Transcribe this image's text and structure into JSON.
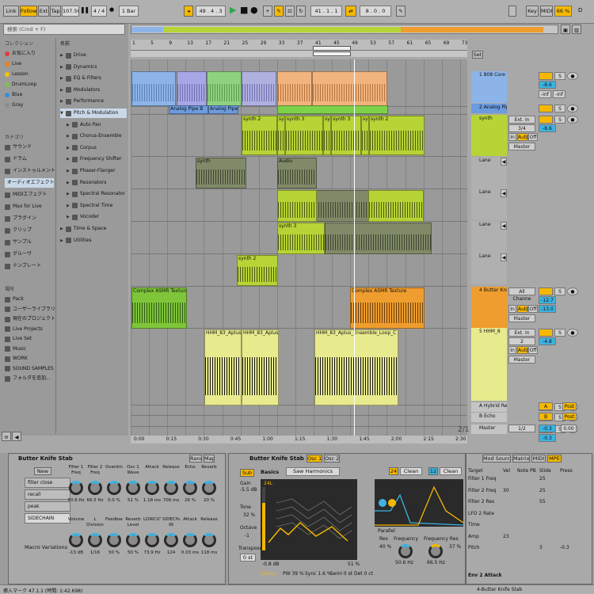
{
  "transport": {
    "link": "Link",
    "follow": "Follow",
    "ext": "Ext",
    "tap": "Tap",
    "tempo": "107.50",
    "signature": "4 / 4",
    "quantize": "1 Bar",
    "position": "49 . 4 . 3",
    "loop_start": "41 . 1 . 1",
    "loop_length": "8 . 0 . 0",
    "key": "Key",
    "midi": "MIDI",
    "cpu": "66 %",
    "d_label": "D"
  },
  "browser": {
    "search_placeholder": "検索 (Cmd + F)",
    "collections_title": "コレクション",
    "collections": [
      {
        "label": "お気に入り",
        "color": "#e03c3c"
      },
      {
        "label": "Live",
        "color": "#f07f1a"
      },
      {
        "label": "Lesson",
        "color": "#f3c300"
      },
      {
        "label": "DrumLoop",
        "color": "#7cc24a"
      },
      {
        "label": "Blue",
        "color": "#3a8edb"
      },
      {
        "label": "Gray",
        "color": "#8c8c8c"
      }
    ],
    "categories_title": "カテゴリ",
    "categories": [
      "サウンド",
      "ドラム",
      "インストゥルメント",
      "オーディオエフェクト",
      "MIDIエフェクト",
      "Max for Live",
      "プラグイン",
      "クリップ",
      "サンプル",
      "グルーヴ",
      "テンプレート"
    ],
    "places_title": "場所",
    "places": [
      "Pack",
      "ユーザーライブラリ",
      "現在のプロジェクト",
      "Live Projects",
      "Live Set",
      "Music",
      "WORK",
      "SOUND SAMPLES",
      "フォルダを追加..."
    ],
    "name_header": "名前",
    "items": [
      {
        "label": "Drive",
        "indent": 0
      },
      {
        "label": "Dynamics",
        "indent": 0
      },
      {
        "label": "EQ & Filters",
        "indent": 0
      },
      {
        "label": "Modulators",
        "indent": 0
      },
      {
        "label": "Performance",
        "indent": 0
      },
      {
        "label": "Pitch & Modulation",
        "indent": 0
      },
      {
        "label": "Auto Pan",
        "indent": 1
      },
      {
        "label": "Chorus-Ensemble",
        "indent": 1
      },
      {
        "label": "Corpus",
        "indent": 1
      },
      {
        "label": "Frequency Shifter",
        "indent": 1
      },
      {
        "label": "Phaser-Flanger",
        "indent": 1
      },
      {
        "label": "Resonators",
        "indent": 1
      },
      {
        "label": "Spectral Resonator",
        "indent": 1
      },
      {
        "label": "Spectral Time",
        "indent": 1
      },
      {
        "label": "Vocoder",
        "indent": 1
      },
      {
        "label": "Time & Space",
        "indent": 0
      },
      {
        "label": "Utilities",
        "indent": 0
      }
    ]
  },
  "ruler": [
    "1",
    "5",
    "9",
    "13",
    "17",
    "21",
    "25",
    "29",
    "33",
    "37",
    "41",
    "45",
    "49",
    "53",
    "57",
    "61",
    "65",
    "69",
    "73"
  ],
  "time_ruler": [
    "0:00",
    "0:15",
    "0:30",
    "0:45",
    "1:00",
    "1:15",
    "1:30",
    "1:45",
    "2:00",
    "2:15",
    "2:30"
  ],
  "page_indicator": "2/1",
  "tracks": [
    {
      "name": "1 808 Core K",
      "color": "#8db4e8",
      "vol": "-8.6",
      "sends": "-inf",
      "clips": []
    },
    {
      "name": "2 Analog Pip",
      "color": "#6c9bde",
      "clips": [
        {
          "label": "Analog Pipe B"
        },
        {
          "label": "Analog Pipe Bass"
        },
        {
          "label": "Al"
        },
        {
          "label": "Anal"
        }
      ]
    },
    {
      "name": "synth",
      "color": "#b7d437",
      "input": "Ext. In",
      "chan": "3/4",
      "vol": "-8.6",
      "out": "Master",
      "clips": [
        {
          "label": "synth 2"
        },
        {
          "label": "sy"
        },
        {
          "label": "synth 3"
        },
        {
          "label": "sy"
        },
        {
          "label": "synth 3"
        },
        {
          "label": "sy"
        },
        {
          "label": "synth 2"
        }
      ]
    },
    {
      "name": "Lane",
      "clips": [
        {
          "label": "synth"
        },
        {
          "label": "Audio"
        }
      ]
    },
    {
      "name": "Lane",
      "clips": [
        {
          "label": "synth 2"
        }
      ]
    },
    {
      "name": "Lane",
      "clips": [
        {
          "label": "synth 3"
        }
      ]
    },
    {
      "name": "Lane",
      "clips": [
        {
          "label": "synth 2"
        }
      ]
    },
    {
      "name": "4 Butter Kni",
      "color": "#ef9d2e",
      "input": "All Channe",
      "vol": "-12.7",
      "send": "-13.0",
      "out": "Master",
      "clips": [
        {
          "label": "Complex ASMR Texture"
        },
        {
          "label": "Complex ASMR Texture"
        }
      ]
    },
    {
      "name": "5 HHM_8",
      "color": "#e8ea8e",
      "input": "Ext. In",
      "chan": "2",
      "vol": "-4.8",
      "out": "Master",
      "clips": [
        {
          "label": "HHM_83_Aplus_Es"
        },
        {
          "label": "HHM_83_Aplus_Es"
        },
        {
          "label": "HHM_83_Aplus_Ensemble_Loop_C"
        }
      ]
    },
    {
      "name": "A Hybrid Re",
      "send_label": "A",
      "post": "Post"
    },
    {
      "name": "B Echo",
      "send_label": "B",
      "post": "Post"
    },
    {
      "name": "Master",
      "quant": "1/2",
      "vol": "-0.3",
      "val2": "0.00"
    }
  ],
  "mixer_labels": {
    "in": "In",
    "auto": "Auto",
    "off": "Off",
    "s": "S",
    "c": "C",
    "set": "Set",
    "inf": "-inf",
    "master": "Master"
  },
  "rack": {
    "title": "Butter Knife Stab",
    "rand": "Rand",
    "map": "Map",
    "new": "New",
    "presets": [
      "filter close",
      "recall",
      "peak",
      "SIDECHAIN"
    ],
    "macro_variations": "Macro Variations",
    "macros": [
      {
        "label": "Filter 1 Freq",
        "value": "50.6 Hz"
      },
      {
        "label": "Filter 2 Freq",
        "value": "66.5 Hz"
      },
      {
        "label": "Overdrive",
        "value": "0.0 %"
      },
      {
        "label": "Osc 1 Wave",
        "value": "51 %"
      },
      {
        "label": "Attack",
        "value": "1.18 ms"
      },
      {
        "label": "Release",
        "value": "706 ms"
      },
      {
        "label": "Echo",
        "value": "26 %"
      },
      {
        "label": "Reverb",
        "value": "20 %"
      },
      {
        "label": "Volume",
        "value": "-13 dB"
      },
      {
        "label": "L Division",
        "value": "1/16"
      },
      {
        "label": "Feedback",
        "value": "50 %"
      },
      {
        "label": "Reverb Level",
        "value": "50 %"
      },
      {
        "label": "LOWCUT",
        "value": "73.9 Hz"
      },
      {
        "label": "SIDECHAIN IN",
        "value": "124"
      },
      {
        "label": "Attack",
        "value": "0.03 ms"
      },
      {
        "label": "Release",
        "value": "118 ms"
      }
    ]
  },
  "synth": {
    "title": "Butter Knife Stab",
    "tabs": [
      "Osc 1",
      "Osc 2"
    ],
    "sub": "Sub",
    "gain_label": "Gain",
    "gain": "-5.5 dB",
    "tone_label": "Tone",
    "tone": "32 %",
    "octave_label": "Octave",
    "octave": "-1",
    "transpose_label": "Transpose",
    "transpose": "0 st",
    "basics": "Basics",
    "harmonics": "Saw Harmonics",
    "level": "24L",
    "db": "-0.8 dB",
    "pct": "51 %",
    "classic": "Classic",
    "pw": "PW 39 %",
    "sync": "Sync 1.6 %",
    "semi": "Semi 0 st",
    "det": "Det 0 ct",
    "filter_n1": "24",
    "filter_n2": "12",
    "clean1": "Clean",
    "clean2": "Clean",
    "parallel": "Parallel",
    "res1_label": "Res",
    "res1": "40 %",
    "freq1_label": "Frequency",
    "freq1": "50.6 Hz",
    "freq2_label": "Frequency Res",
    "freq2": "66.5 Hz",
    "res2": "37 %",
    "mod_tabs": [
      "Mod Sources",
      "Matrix",
      "MIDI",
      "MPE"
    ],
    "mpe_cols": [
      "Target",
      "Vel",
      "Note PB",
      "Slide",
      "Press"
    ],
    "mpe_rows": [
      {
        "target": "Filter 1 Freq",
        "vel": "",
        "slide": "25",
        "press": ""
      },
      {
        "target": "Filter 2 Freq",
        "vel": "30",
        "slide": "25",
        "press": ""
      },
      {
        "target": "Filter 2 Res",
        "vel": "",
        "slide": "55",
        "press": ""
      },
      {
        "target": "LFO 2 Rate",
        "vel": "",
        "slide": "",
        "press": ""
      },
      {
        "target": "Time",
        "vel": "",
        "slide": "",
        "press": ""
      },
      {
        "target": "Amp",
        "vel": "23",
        "slide": "",
        "press": ""
      },
      {
        "target": "Pitch",
        "vel": "",
        "slide": "3",
        "press": "-0.3"
      }
    ],
    "env2": "Env 2 Attack"
  },
  "status": {
    "left": "挿入マーク 47.1.1 (時間: 1:42.698)",
    "right": "4-Butter Knife Stab"
  }
}
